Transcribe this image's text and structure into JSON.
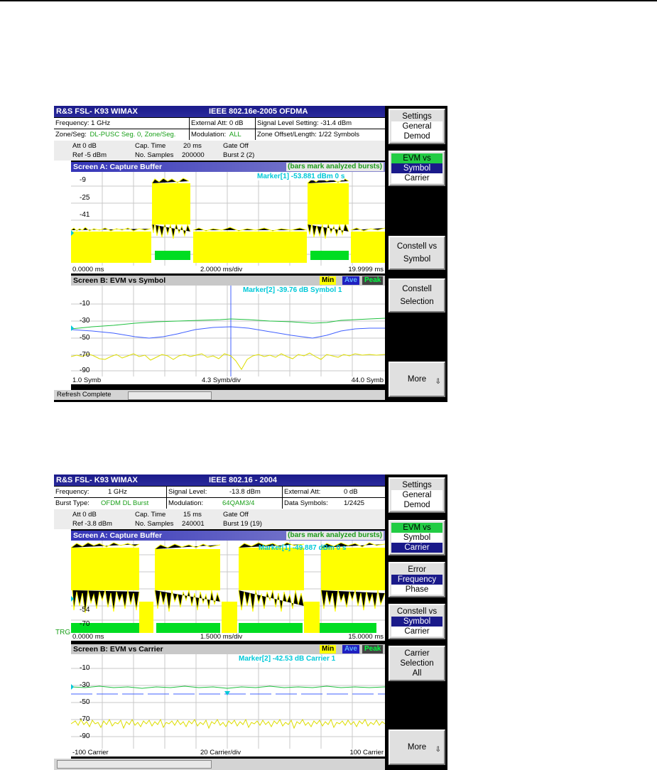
{
  "screen1": {
    "title_left": "R&S FSL- K93   WIMAX",
    "title_center": "IEEE 802.16e-2005 OFDMA",
    "row1": {
      "frequency": "Frequency: 1 GHz",
      "ext_att": "External Att: 0 dB",
      "signal_level": "Signal Level Setting: -31.4 dBm"
    },
    "row2": {
      "zone_label": "Zone/Seg:",
      "zone_value": "DL-PUSC Seg. 0, Zone/Seg.",
      "modulation_label": "Modulation:",
      "modulation_value": "ALL",
      "zone_offset": "Zone Offset/Length:  1/22 Symbols"
    },
    "params": {
      "att": "Att   0 dB",
      "ref": "Ref   -5 dBm",
      "cap_time_label": "Cap. Time",
      "cap_time_value": "20 ms",
      "samples_label": "No. Samples",
      "samples_value": "200000",
      "gate": "Gate Off",
      "burst": "Burst 2 (2)"
    },
    "screen_a": {
      "title": "Screen A: Capture Buffer",
      "note": "(bars mark analyzed bursts)",
      "marker": "Marker[1]    -53.881 dBm   0 s",
      "y_labels": [
        "-9",
        "-25",
        "-41"
      ],
      "x_left": "0.0000 ms",
      "x_center": "2.0000 ms/div",
      "x_right": "19.9999 ms"
    },
    "screen_b": {
      "title": "Screen B: EVM vs Symbol",
      "legend_min": "Min",
      "legend_ave": "Ave",
      "legend_peak": "Peak",
      "marker": "Marker[2]    -39.76 dB   Symbol 1",
      "y_labels": [
        "-10",
        "-30",
        "-50",
        "-70",
        "-90"
      ],
      "x_left": "1.0 Symb",
      "x_center": "4.3 Symb/div",
      "x_right": "44.0 Symb"
    },
    "status": "Refresh Complete",
    "softkeys": {
      "settings": [
        "Settings",
        "General",
        "Demod"
      ],
      "evm": [
        "EVM vs",
        "Symbol",
        "Carrier"
      ],
      "constell_vs_symbol": [
        "Constell vs",
        "Symbol"
      ],
      "constell_selection": [
        "Constell",
        "Selection"
      ],
      "more": "More",
      "more_arrow": "⇩"
    }
  },
  "screen2": {
    "title_left": "R&S FSL- K93   WIMAX",
    "title_center": "IEEE 802.16 - 2004",
    "row1": {
      "frequency_label": "Frequency:",
      "frequency_value": "1 GHz",
      "signal_level_label": "Signal Level:",
      "signal_level_value": "-13.8 dBm",
      "ext_att_label": "External Att:",
      "ext_att_value": "0 dB"
    },
    "row2": {
      "burst_label": "Burst Type:",
      "burst_value": "OFDM DL Burst",
      "modulation_label": "Modulation:",
      "modulation_value": "64QAM3/4",
      "data_symbols_label": "Data Symbols:",
      "data_symbols_value": "1/2425"
    },
    "params": {
      "att": "Att   0 dB",
      "ref": "Ref   -3.8 dBm",
      "cap_time_label": "Cap. Time",
      "cap_time_value": "15 ms",
      "samples_label": "No. Samples",
      "samples_value": "240001",
      "gate": "Gate Off",
      "burst": "Burst 19 (19)"
    },
    "screen_a": {
      "title": "Screen A: Capture Buffer",
      "note": "(bars mark analyzed bursts)",
      "marker": "Marker[1]   -49.887 dBm   0 s",
      "y_labels": [
        "-54",
        "-70"
      ],
      "trg": "TRG",
      "x_left": "0.0000 ms",
      "x_center": "1.5000 ms/div",
      "x_right": "15.0000 ms"
    },
    "screen_b": {
      "title": "Screen B: EVM vs Carrier",
      "legend_min": "Min",
      "legend_ave": "Ave",
      "legend_peak": "Peak",
      "marker": "Marker[2]    -42.53 dB   Carrier   1",
      "y_labels": [
        "-10",
        "-30",
        "-50",
        "-70",
        "-90"
      ],
      "x_left": "-100 Carrier",
      "x_center": "20 Carrier/div",
      "x_right": "100 Carrier"
    },
    "softkeys": {
      "settings": [
        "Settings",
        "General",
        "Demod"
      ],
      "evm": [
        "EVM vs",
        "Symbol",
        "Carrier"
      ],
      "error": [
        "Error",
        "Frequency",
        "Phase"
      ],
      "constell": [
        "Constell vs",
        "Symbol",
        "Carrier"
      ],
      "carrier_selection": [
        "Carrier",
        "Selection",
        "All"
      ],
      "more": "More",
      "more_arrow": "⇩"
    }
  },
  "colors": {
    "trace_yellow": "#ffff00",
    "burst_green": "#00dd22",
    "ave_blue": "#4060ff",
    "peak_green": "#20c040",
    "marker_cyan": "#00c8d8"
  }
}
